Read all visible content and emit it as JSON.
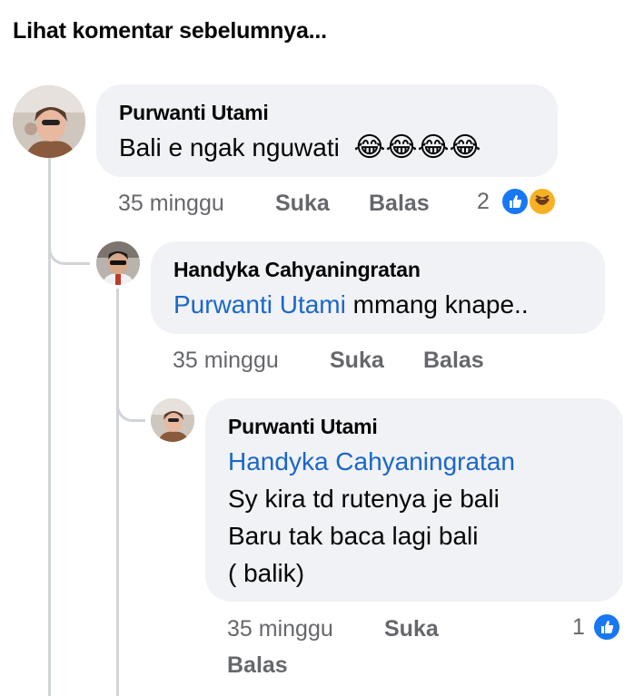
{
  "see_previous": "Lihat komentar sebelumnya...",
  "comments": [
    {
      "author": "Purwanti Utami",
      "text": "Bali e ngak nguwati",
      "emojis": "😂😂😂😂",
      "time": "35 minggu",
      "like_label": "Suka",
      "reply_label": "Balas",
      "reaction_count": "2",
      "reactions": [
        "like-icon",
        "laugh-icon"
      ]
    },
    {
      "author": "Handyka Cahyaningratan",
      "mention": "Purwanti Utami",
      "text": " mmang knape..",
      "time": "35 minggu",
      "like_label": "Suka",
      "reply_label": "Balas"
    },
    {
      "author": "Purwanti Utami",
      "mention": "Handyka Cahyaningratan",
      "lines": [
        "Sy kira td rutenya je bali",
        "Baru tak baca lagi bali",
        "( balik)"
      ],
      "time": "35 minggu",
      "like_label": "Suka",
      "reply_label": "Balas",
      "reaction_count": "1",
      "reactions": [
        "like-icon"
      ]
    }
  ],
  "colors": {
    "bubble": "#f0f2f5",
    "mention": "#1b66c9",
    "meta": "#65676b",
    "like_blue": "#1877f2",
    "haha_yellow": "#f7b125"
  }
}
